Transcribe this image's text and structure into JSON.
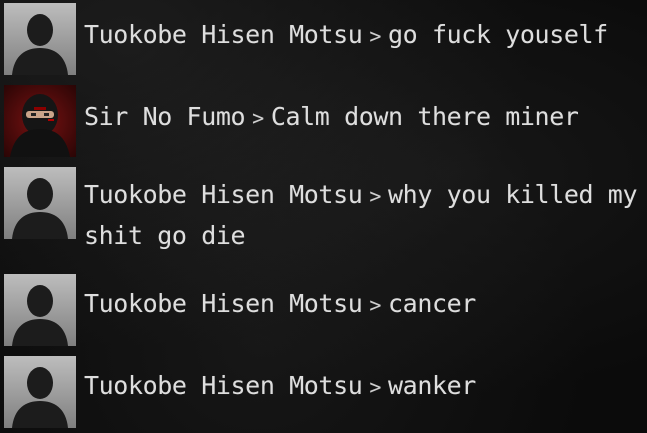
{
  "chat": {
    "messages": [
      {
        "avatar": "silhouette-avatar",
        "sender": "Tuokobe Hisen Motsu",
        "separator": ">",
        "text": "go fuck youself"
      },
      {
        "avatar": "ninja-avatar",
        "sender": "Sir No Fumo",
        "separator": ">",
        "text": "Calm down there miner"
      },
      {
        "avatar": "silhouette-avatar",
        "sender": "Tuokobe Hisen Motsu",
        "separator": ">",
        "text": "why you killed my shit go die"
      },
      {
        "avatar": "silhouette-avatar",
        "sender": "Tuokobe Hisen Motsu",
        "separator": ">",
        "text": "cancer"
      },
      {
        "avatar": "silhouette-avatar",
        "sender": "Tuokobe Hisen Motsu",
        "separator": ">",
        "text": "wanker"
      }
    ]
  }
}
